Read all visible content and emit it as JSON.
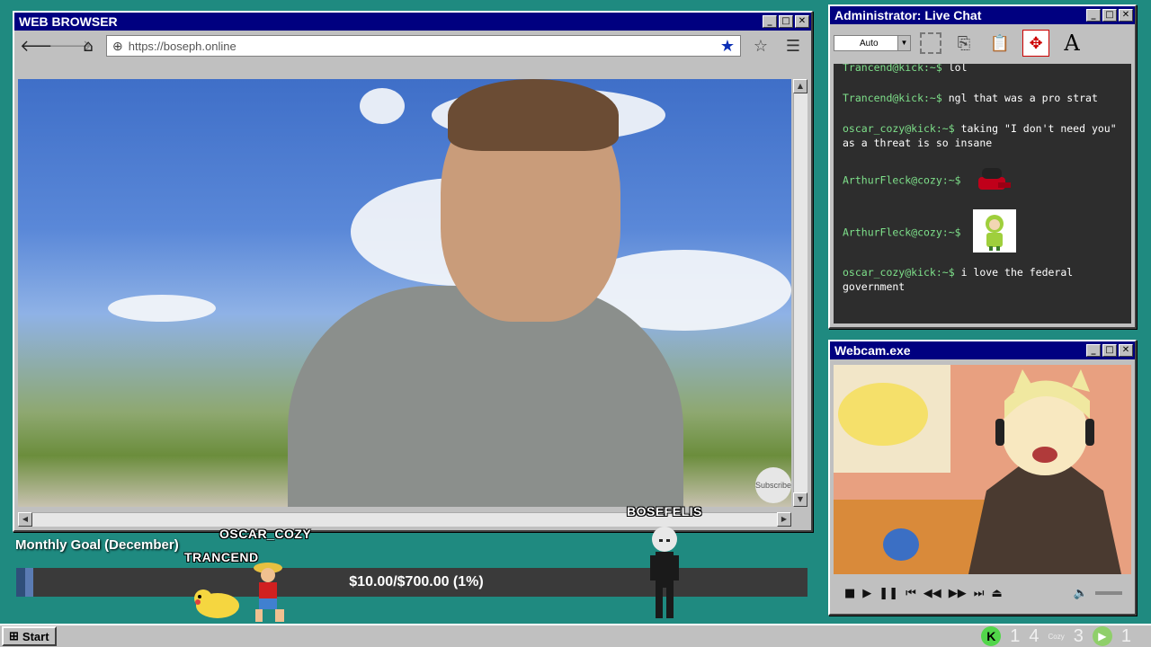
{
  "browser": {
    "title": "WEB BROWSER",
    "url": "https://boseph.online",
    "subscribe_label": "Subscribe"
  },
  "window_controls": {
    "minimize": "_",
    "maximize": "□",
    "close": "✕"
  },
  "chat": {
    "title": "Administrator: Live Chat",
    "font_size_select": "Auto",
    "messages": [
      {
        "handle": "Trancend@kick:~$",
        "text": "lol"
      },
      {
        "handle": "Trancend@kick:~$",
        "text": "ngl that was a pro strat"
      },
      {
        "handle": "oscar_cozy@kick:~$",
        "text": "taking \"I don't need you\" as a threat is so insane"
      },
      {
        "handle": "ArthurFleck@cozy:~$",
        "text": "",
        "sticker": "red-cap-sticker"
      },
      {
        "handle": "ArthurFleck@cozy:~$",
        "text": "",
        "sticker": "green-character-sticker"
      },
      {
        "handle": "oscar_cozy@kick:~$",
        "text": "i love the federal government"
      }
    ]
  },
  "webcam": {
    "title": "Webcam.exe"
  },
  "goal": {
    "label": "Monthly Goal (December)",
    "text": "$10.00/$700.00 (1%)",
    "progress_fraction": 0.01
  },
  "viewers": {
    "oscar": "OSCAR_COZY",
    "trancend": "TRANCEND",
    "bosefelis": "BOSEFELIS"
  },
  "taskbar": {
    "start_label": "Start",
    "tray_values": [
      "1",
      "4",
      "3",
      "1"
    ],
    "tray_mini_label": "Cozy"
  },
  "colors": {
    "desktop": "#1f8a80",
    "titlebar": "#000080",
    "chat_handle": "#7ee08a",
    "kick_green": "#52d64a"
  }
}
